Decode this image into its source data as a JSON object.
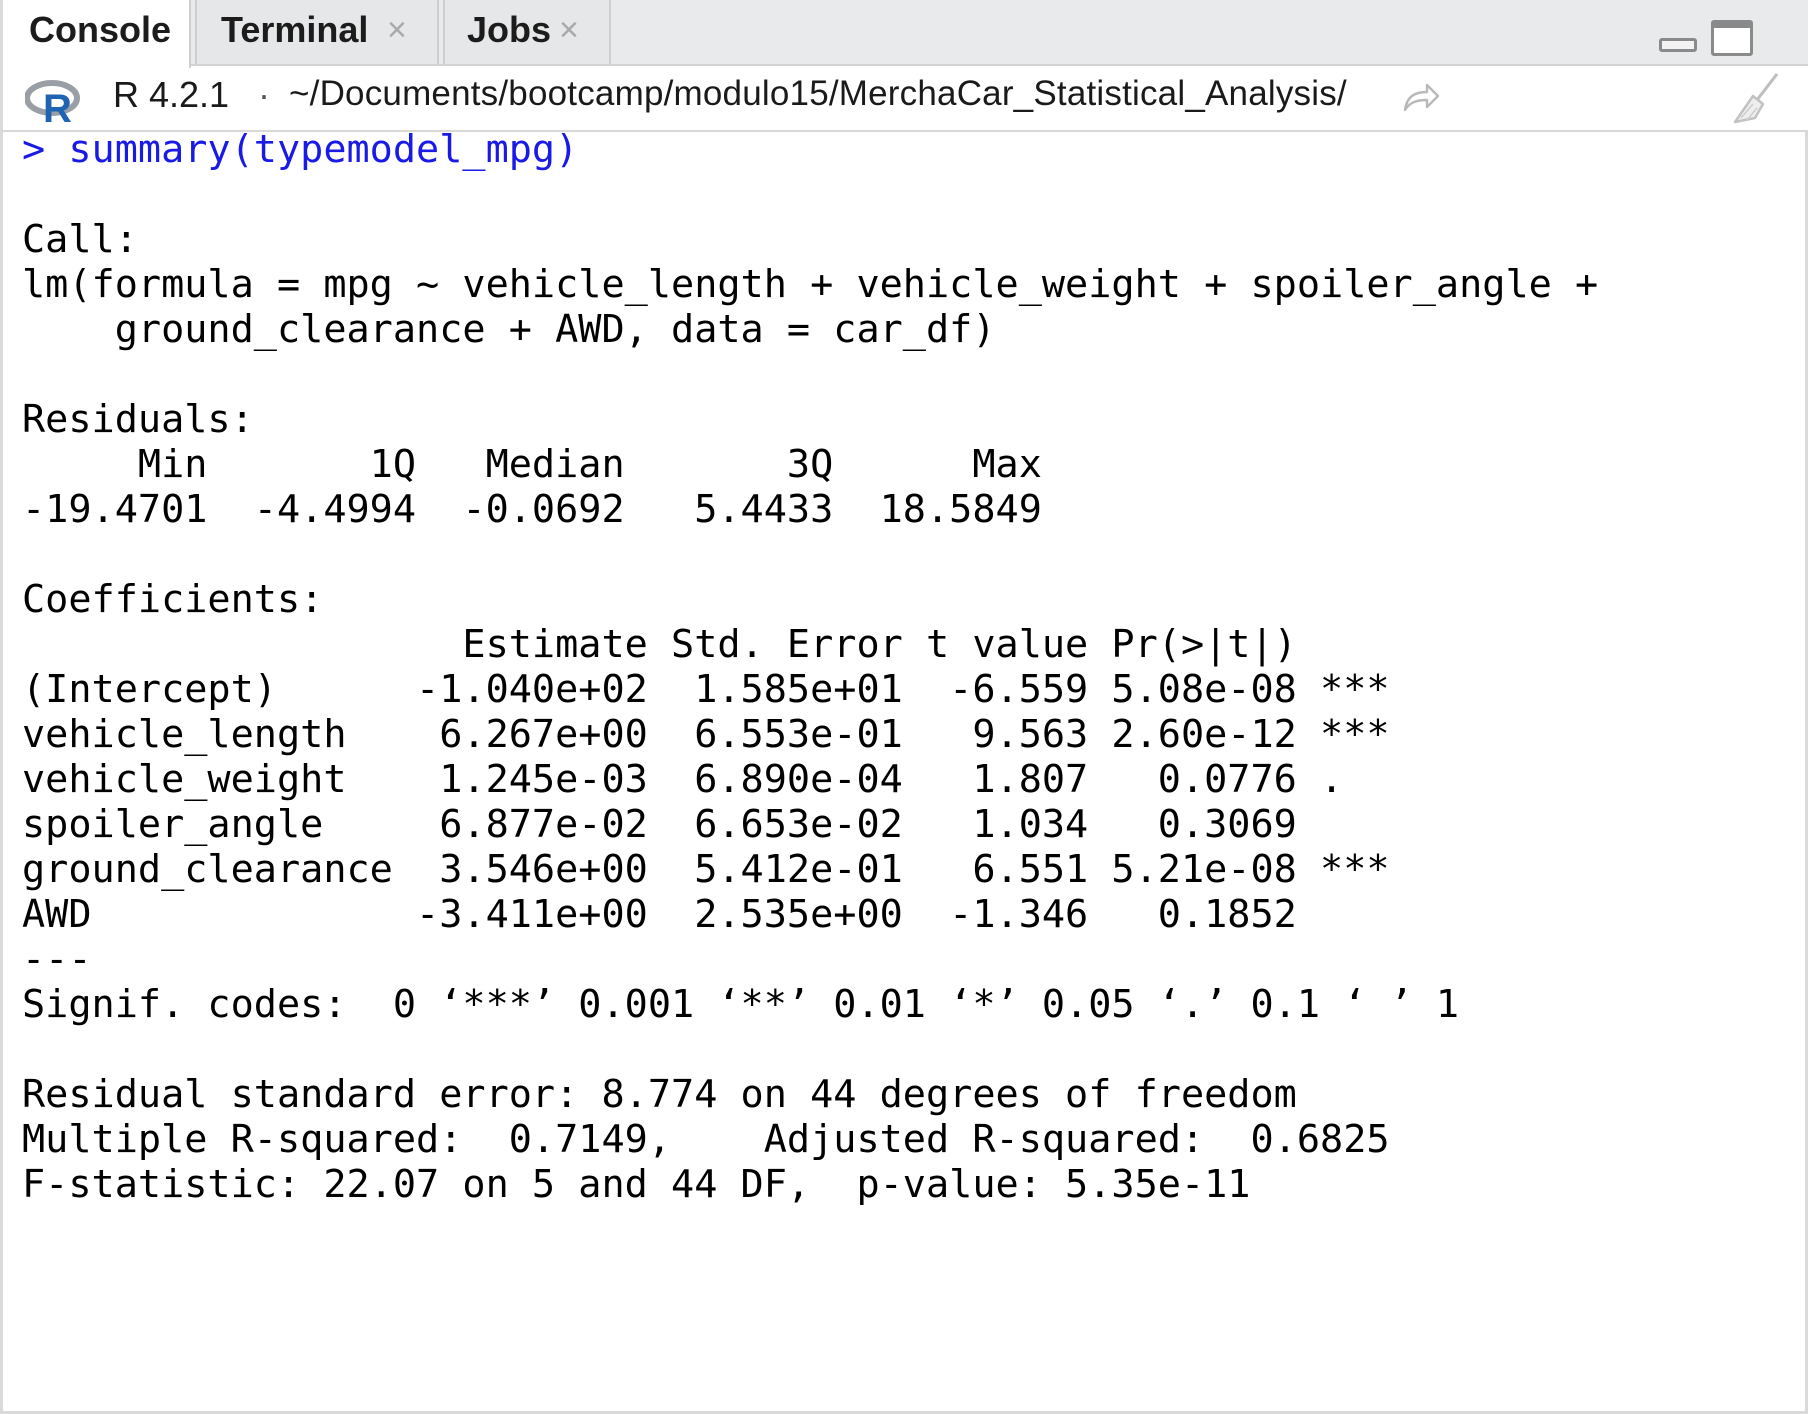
{
  "tabs": [
    {
      "label": "Console",
      "active": true,
      "closable": false
    },
    {
      "label": "Terminal",
      "active": false,
      "closable": true,
      "close_glyph": "×"
    },
    {
      "label": "Jobs",
      "active": false,
      "closable": true,
      "close_glyph": "×"
    }
  ],
  "toolbar": {
    "r_version": "R 4.2.1",
    "separator": "·",
    "working_dir": "~/Documents/bootcamp/modulo15/MerchaCar_Statistical_Analysis/"
  },
  "colors": {
    "command_text": "#1a1ae6",
    "output_text": "#000000",
    "r_logo_blue": "#1f63b2",
    "r_logo_grey": "#9a9ea5"
  },
  "console": {
    "lines": [
      "> summary(typemodel_mpg)",
      "",
      "Call:",
      "lm(formula = mpg ~ vehicle_length + vehicle_weight + spoiler_angle + ",
      "    ground_clearance + AWD, data = car_df)",
      "",
      "Residuals:",
      "     Min       1Q   Median       3Q      Max ",
      "-19.4701  -4.4994  -0.0692   5.4433  18.5849 ",
      "",
      "Coefficients:",
      "                   Estimate Std. Error t value Pr(>|t|)    ",
      "(Intercept)      -1.040e+02  1.585e+01  -6.559 5.08e-08 ***",
      "vehicle_length    6.267e+00  6.553e-01   9.563 2.60e-12 ***",
      "vehicle_weight    1.245e-03  6.890e-04   1.807   0.0776 .  ",
      "spoiler_angle     6.877e-02  6.653e-02   1.034   0.3069    ",
      "ground_clearance  3.546e+00  5.412e-01   6.551 5.21e-08 ***",
      "AWD              -3.411e+00  2.535e+00  -1.346   0.1852    ",
      "---",
      "Signif. codes:  0 ‘***’ 0.001 ‘**’ 0.01 ‘*’ 0.05 ‘.’ 0.1 ‘ ’ 1",
      "",
      "Residual standard error: 8.774 on 44 degrees of freedom",
      "Multiple R-squared:  0.7149,\tAdjusted R-squared:  0.6825 ",
      "F-statistic: 22.07 on 5 and 44 DF,  p-value: 5.35e-11"
    ]
  }
}
